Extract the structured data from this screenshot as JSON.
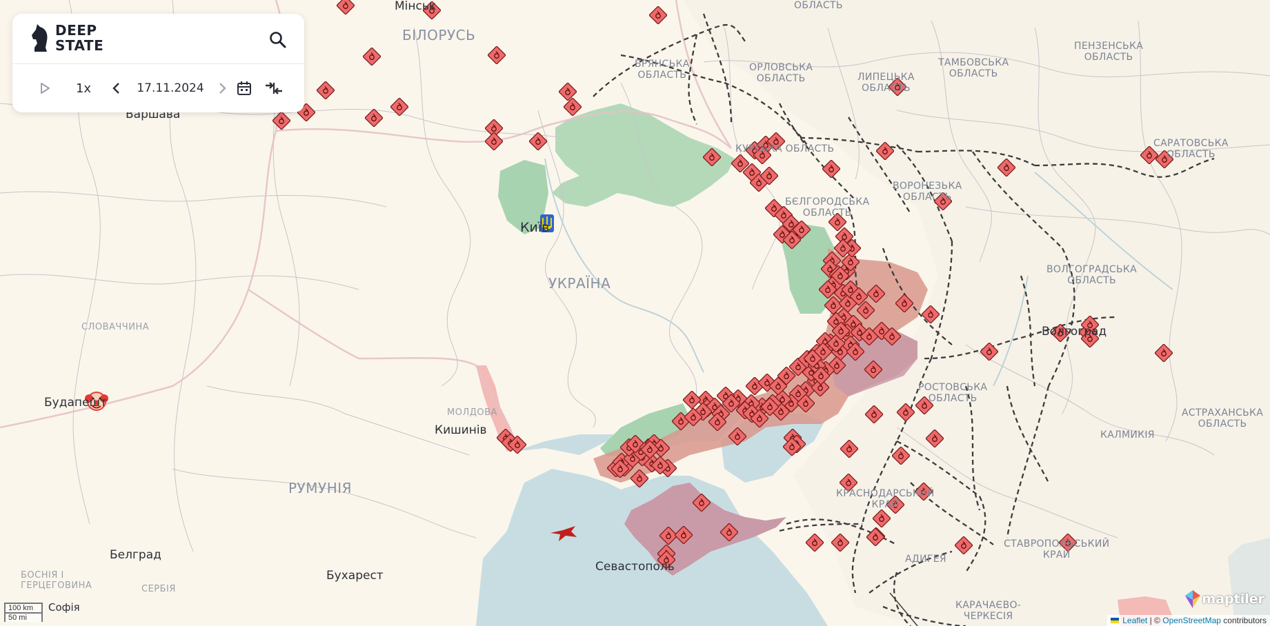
{
  "app": {
    "brand": "DEEP STATE",
    "brand_line1": "DEEP",
    "brand_line2": "STATE"
  },
  "controls": {
    "speed": "1x",
    "date": "17.11.2024"
  },
  "labels": {
    "countries": {
      "belarus": "БІЛОРУСЬ",
      "ukraine": "УКРАЇНА",
      "romania": "РУМУНІЯ",
      "slovakia": "СЛОВАЧЧИНА",
      "moldova": "МОЛДОВА",
      "serbia": "СЕРБІЯ",
      "bosnia_1": "БОСНІЯ І",
      "bosnia_2": "ГЕРЦЕГОВИНА"
    },
    "cities": {
      "minsk": "Мінськ",
      "warsaw": "Варшава",
      "kyiv": "Київ",
      "budapest": "Будапешт",
      "chisinau": "Кишинів",
      "belgrade": "Белград",
      "bucharest": "Бухарест",
      "sevastopol": "Севастополь",
      "volgograd": "Волгоград",
      "sofia_part": "Софія"
    },
    "regions": {
      "oblast_top": "ОБЛАСТЬ",
      "bryansk_1": "БРЯНСЬКА",
      "bryansk_2": "ОБЛАСТЬ",
      "orel_1": "ОРЛОВСЬКА",
      "orel_2": "ОБЛАСТЬ",
      "lipetsk_1": "ЛИПЕЦЬКА",
      "lipetsk_2": "ОБЛАСТЬ",
      "tambov_1": "ТАМБОВСЬКА",
      "tambov_2": "ОБЛАСТЬ",
      "penza_1": "ПЕНЗЕНСЬКА",
      "penza_2": "ОБЛАСТЬ",
      "kursk": "КУРСЬКА ОБЛАСТЬ",
      "voronezh_1": "ВОРОНЕЗЬКА",
      "voronezh_2": "ОБЛАСТЬ",
      "saratov_1": "САРАТОВСЬКА",
      "saratov_2": "ОБЛАСТЬ",
      "belgorod_1": "БЄЛГОРОДСЬКА",
      "belgorod_2": "ОБЛАСТЬ",
      "volgograd_1": "ВОЛГОГРАДСЬКА",
      "volgograd_2": "ОБЛАСТЬ",
      "rostov_1": "РОСТОВСЬКА",
      "rostov_2": "ОБЛАСТЬ",
      "astrakhan_1": "АСТРАХАНСЬКА",
      "astrakhan_2": "ОБЛАСТЬ",
      "kalmykia": "КАЛМИКІЯ",
      "krasnodar_1": "КРАСНОДАРСЬКИЙ",
      "krasnodar_2": "КРАЙ",
      "stavropol_1": "СТАВРОПОЛЬСЬКИЙ",
      "stavropol_2": "КРАЙ",
      "adygea": "АДИГЕЯ",
      "kch_1": "КАРАЧАЄВО-",
      "kch_2": "ЧЕРКЕСІЯ"
    }
  },
  "scale": {
    "km": "100 km",
    "mi": "50 mi"
  },
  "attribution": {
    "leaflet": "Leaflet",
    "separator": "| ©",
    "osm": "OpenStreetMap",
    "contributors": "contributors"
  },
  "maptiler": "maptiler",
  "colors": {
    "land": "#fbf6ec",
    "sea": "#c8dde2",
    "occupied": "#d8988c",
    "occupied_pre2022": "#c99aa8",
    "liberated": "#a7d3b0",
    "marker": "#ee6a6a"
  }
}
